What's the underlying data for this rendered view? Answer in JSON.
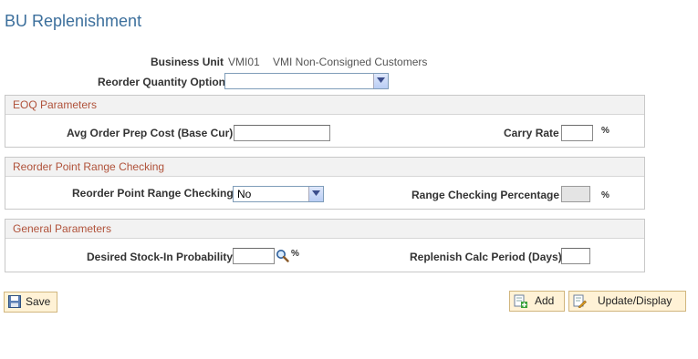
{
  "page": {
    "title": "BU Replenishment"
  },
  "business_unit": {
    "label": "Business Unit",
    "code": "VMI01",
    "description": "VMI Non-Consigned Customers"
  },
  "reorder_quantity_option": {
    "label": "Reorder Quantity Option",
    "value": ""
  },
  "eoq": {
    "header": "EOQ Parameters",
    "avg_order_prep_cost": {
      "label": "Avg Order Prep Cost (Base Cur)",
      "value": ""
    },
    "carry_rate": {
      "label": "Carry Rate",
      "value": "",
      "unit": "%"
    }
  },
  "reorder_point": {
    "header": "Reorder Point Range Checking",
    "range_checking": {
      "label": "Reorder Point Range Checking",
      "value": "No"
    },
    "range_checking_pct": {
      "label": "Range Checking Percentage",
      "value": "",
      "unit": "%"
    }
  },
  "general": {
    "header": "General Parameters",
    "stock_in_probability": {
      "label": "Desired Stock-In Probability",
      "value": "",
      "unit": "%"
    },
    "replenish_calc_period": {
      "label": "Replenish Calc Period (Days)",
      "value": ""
    }
  },
  "buttons": {
    "save": "Save",
    "add": "Add",
    "update_display": "Update/Display"
  }
}
